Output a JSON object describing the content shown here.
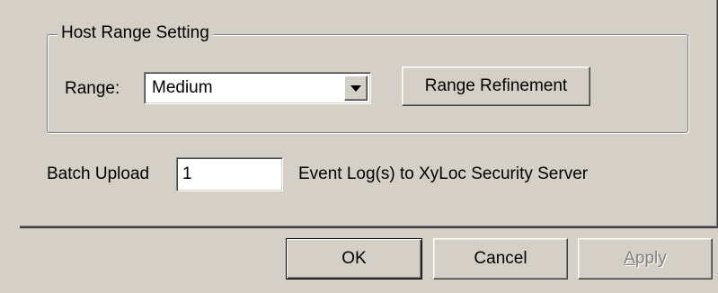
{
  "group": {
    "title": "Host Range Setting"
  },
  "range": {
    "label": "Range:",
    "selected": "Medium",
    "refine_button": "Range Refinement"
  },
  "batch": {
    "label": "Batch Upload",
    "value": "1",
    "suffix": "Event Log(s) to XyLoc Security Server"
  },
  "buttons": {
    "ok": "OK",
    "cancel": "Cancel",
    "apply": "Apply"
  }
}
